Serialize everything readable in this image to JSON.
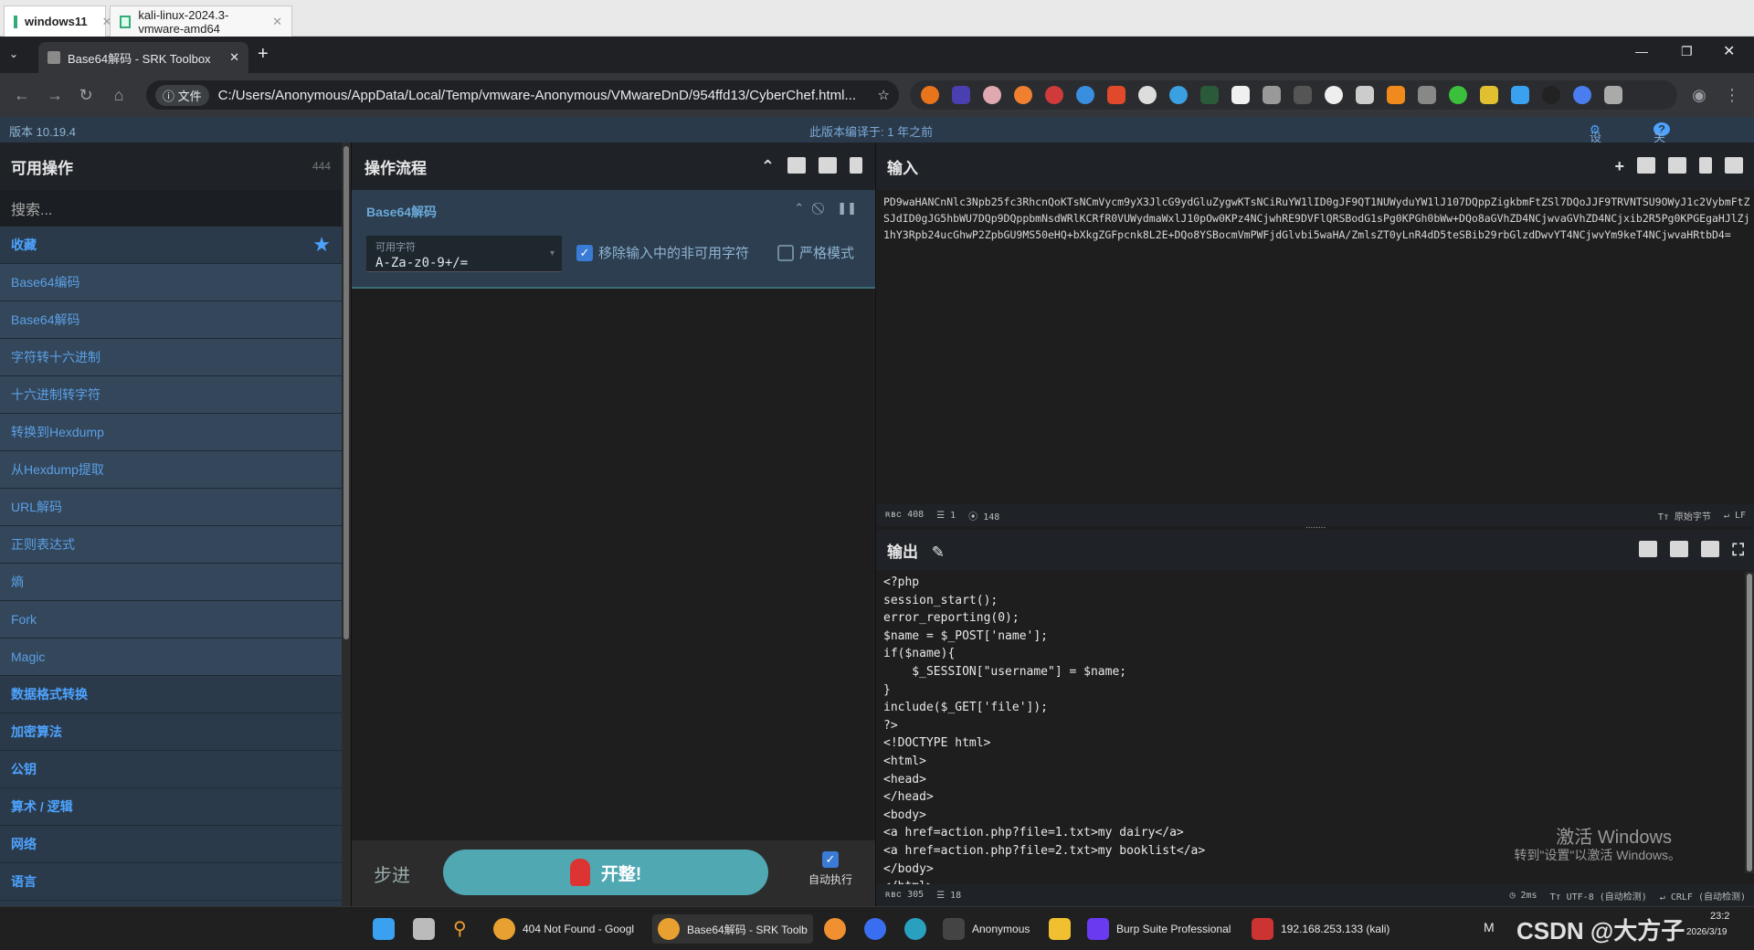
{
  "vm_tabs": [
    "windows11",
    "kali-linux-2024.3-vmware-amd64"
  ],
  "browser": {
    "tab_title": "Base64解码 - SRK Toolbox",
    "file_chip": "文件",
    "url": "C:/Users/Anonymous/AppData/Local/Temp/vmware-Anonymous/VMwareDnD/954ffd13/CyberChef.html..."
  },
  "banner": {
    "version": "版本 10.19.4",
    "compiled": "此版本编译于:  1 年之前",
    "settings": "设置",
    "about": "关于 / 帮助"
  },
  "ops": {
    "title": "可用操作",
    "count": "444",
    "search_placeholder": "搜索...",
    "favourites": "收藏",
    "operations": [
      "Base64编码",
      "Base64解码",
      "字符转十六进制",
      "十六进制转字符",
      "转换到Hexdump",
      "从Hexdump提取",
      "URL解码",
      "正则表达式",
      "熵",
      "Fork",
      "Magic"
    ],
    "categories": [
      "数据格式转换",
      "加密算法",
      "公钥",
      "算术 / 逻辑",
      "网络",
      "语言"
    ]
  },
  "recipe": {
    "title": "操作流程",
    "op_name": "Base64解码",
    "alphabet_label": "可用字符",
    "alphabet_value": "A-Za-z0-9+/=",
    "remove_nonalpha": "移除输入中的非可用字符",
    "strict_mode": "严格模式",
    "step": "步进",
    "bake": "开整!",
    "auto_bake": "自动执行"
  },
  "input": {
    "title": "输入",
    "text": "PD9waHANCnNlc3Npb25fc3RhcnQoKTsNCmVycm9yX3JlcG9ydGluZygwKTsNCiRuYW1lID0gJF9QT1NUWyduYW1lJ107DQppZigkbmFtZSl7DQoJJF9TRVNTSU9OWyJ1c2VybmFtZSJdID0gJG5hbWU7DQp9DQppbmNsdWRlKCRfR0VUWydmaWxlJ10pOw0KPz4NCjwhRE9DVFlQRSBodG1sPg0KPGh0bWw+DQo8aGVhZD4NCjwvaGVhZD4NCjxib2R5Pg0KPGEgaHJlZj1hY3Rpb24ucGhwP2ZpbGU9MS50eHQ+bXkgZGFpcnk8L2E+DQo8YSBocmVmPWFjdGlvbi5waHA/ZmlsZT0yLnR4dD5teSBib29rbGlzdDwvYT4NCjwvYm9keT4NCjwvaHRtbD4=",
    "stat_length": "408",
    "stat_lines": "1",
    "stat_pos": "148",
    "raw_bytes": "原始字节",
    "eol": "LF"
  },
  "output": {
    "title": "输出",
    "lines": [
      "<?php",
      "session_start();",
      "error_reporting(0);",
      "$name = $_POST['name'];",
      "if($name){",
      "    $_SESSION[\"username\"] = $name;",
      "}",
      "include($_GET['file']);",
      "?>",
      "<!DOCTYPE html>",
      "<html>",
      "<head>",
      "</head>",
      "<body>",
      "<a href=action.php?file=1.txt>my dairy</a>",
      "<a href=action.php?file=2.txt>my booklist</a>",
      "</body>",
      "</html>"
    ],
    "stat_length": "305",
    "stat_lines": "18",
    "time": "2ms",
    "encoding": "UTF-8 (自动检测)",
    "eol": "CRLF (自动检测)"
  },
  "watermark": {
    "line1": "激活 Windows",
    "line2": "转到\"设置\"以激活 Windows。",
    "csdn": "CSDN @大方子"
  },
  "taskbar": {
    "chrome1": "404 Not Found - Googl",
    "chrome2": "Base64解码 - SRK Toolb",
    "terminal": "Anonymous",
    "burp": "Burp Suite Professional",
    "vm": "192.168.253.133 (kali)",
    "time": "23:2",
    "date": "2026/3/19"
  },
  "colors": {
    "accent": "#4da3ff",
    "bake": "#50a8b3",
    "panel": "#2b3a4a"
  }
}
